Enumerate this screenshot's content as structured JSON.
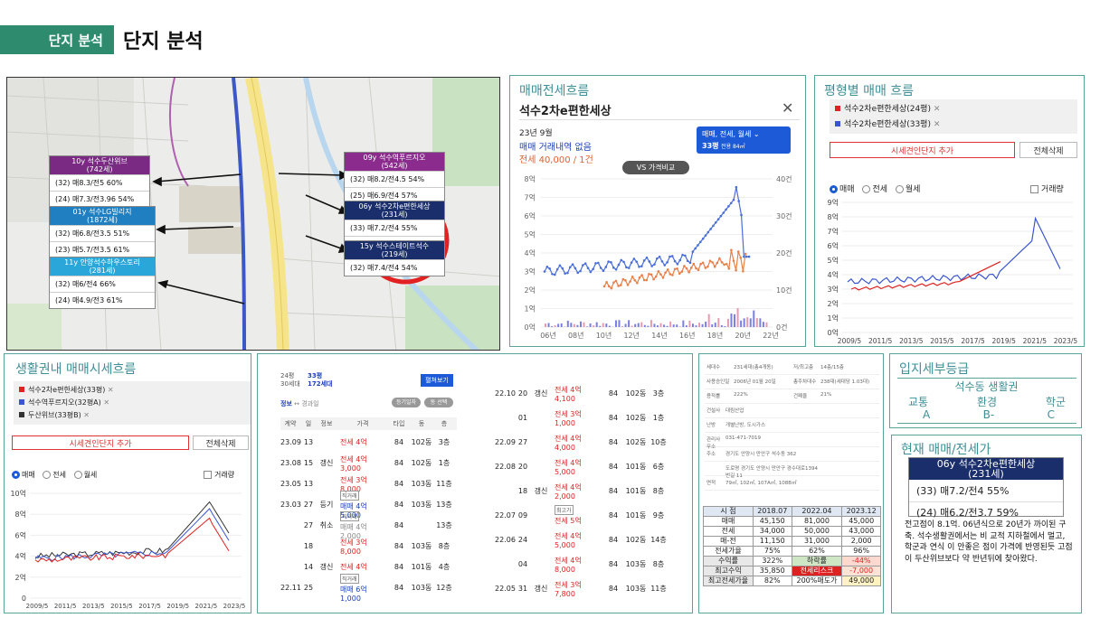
{
  "header": {
    "tag": "단지 분석",
    "title": "단지 분석"
  },
  "map": {
    "boxes": [
      {
        "head": "10y 석수두산위브\n(742세)",
        "rows": [
          "(32) 매8.3/전5 60%",
          "(24) 매7.3/전3.96 54%"
        ],
        "color": "#7a2a83"
      },
      {
        "head": "01y 석수LG빌리지\n(1872세)",
        "rows": [
          "(32) 매6.8/전3.5 51%",
          "(23) 매5.7/전3.5 61%"
        ],
        "color": "#1f7fc0"
      },
      {
        "head": "11y 안양석수하우스토리\n(281세)",
        "rows": [
          "(32) 매6/전4 66%",
          "(24) 매4.9/전3 61%"
        ],
        "color": "#2aa7d8"
      },
      {
        "head": "09y 석수역푸르지오\n(542세)",
        "rows": [
          "(32) 매8.2/전4.5 54%",
          "(25) 매6.9/전4 57%"
        ],
        "color": "#8a2b8d"
      },
      {
        "head": "06y 석수2차e편한세상\n(231세)",
        "rows": [
          "(33) 매7.2/전4 55%",
          "(24) 매6.2/전3.7 59%"
        ],
        "color": "#1a2e6c"
      },
      {
        "head": "15y 석수스테이트석수\n(219세)",
        "rows": [
          "(32) 매7.4/전4 54%"
        ],
        "color": "#1a2e6c"
      }
    ]
  },
  "flow": {
    "title": "매매전세흐름",
    "name": "석수2차e편한세상",
    "date": "23년 9월",
    "no_trade": "매매 거래내역 없음",
    "jeonse": "전세 40,000 / 1건",
    "vs": "VS 가격비교",
    "type_sel": "매매, 전세, 월세",
    "area_sel": "33평",
    "area_sub": "전용 84㎡",
    "y_left": [
      "8억",
      "7억",
      "6억",
      "5억",
      "4억",
      "3억",
      "2억",
      "1억",
      "0억"
    ],
    "y_right": [
      "40건",
      "30건",
      "20건",
      "10건",
      "0건"
    ],
    "x": [
      "06년",
      "08년",
      "10년",
      "12년",
      "14년",
      "16년",
      "18년",
      "20년",
      "22년"
    ]
  },
  "area_flow": {
    "title": "평형별 매매 흐름",
    "legend": [
      "석수2차e편한세상(24평)",
      "석수2차e편한세상(33평)"
    ],
    "add_btn": "시세견인단지 추가",
    "del_btn": "전체삭제",
    "radios": [
      "매매",
      "전세",
      "월세"
    ],
    "vol": "거래량",
    "y": [
      "9억",
      "8억",
      "7억",
      "6억",
      "5억",
      "4억",
      "3억",
      "2억",
      "1억",
      "0억"
    ],
    "x": [
      "2009/5",
      "2011/5",
      "2013/5",
      "2015/5",
      "2017/5",
      "2019/5",
      "2021/5",
      "2023/5"
    ]
  },
  "life": {
    "title": "생활권내 매매시세흐름",
    "legend": [
      "석수2차e편한세상(33평)",
      "석수역푸르지오(32평A)",
      "두산위브(33평B)"
    ],
    "add_btn": "시세견인단지 추가",
    "del_btn": "전체삭제",
    "radios": [
      "매매",
      "전세",
      "월세"
    ],
    "vol": "거래량",
    "y": [
      "10억",
      "8억",
      "6억",
      "4억",
      "2억",
      "0"
    ],
    "x": [
      "2009/5",
      "2011/5",
      "2013/5",
      "2015/5",
      "2017/5",
      "2019/5",
      "2021/5",
      "2023/5"
    ]
  },
  "trades": {
    "left_info": [
      "24평",
      "30세대"
    ],
    "sel_area": "33평",
    "sel_units": "172세대",
    "fold": "펼쳐보기",
    "tabs": [
      "정보",
      "경과일"
    ],
    "pills": [
      "등기일자",
      "동 선택"
    ],
    "headers": [
      "계약",
      "일",
      "정보",
      "가격",
      "타입",
      "동",
      "층"
    ],
    "rows_left": [
      {
        "m": "23.09",
        "d": "13",
        "i": "",
        "p": "전세 4억",
        "t": "84",
        "b": "102동",
        "f": "3층",
        "c": "red"
      },
      {
        "m": "23.08",
        "d": "15",
        "i": "갱신",
        "p": "전세 4억 3,000",
        "t": "84",
        "b": "102동",
        "f": "1층",
        "c": "red"
      },
      {
        "m": "23.05",
        "d": "13",
        "i": "",
        "p": "전세 3억 8,000",
        "t": "84",
        "b": "103동",
        "f": "11층",
        "c": "red"
      },
      {
        "m": "23.03",
        "d": "27",
        "i": "등기",
        "p": "매매 4억 5,000",
        "t": "84",
        "b": "103동",
        "f": "13층",
        "c": "blue",
        "tag": "직거래"
      },
      {
        "m": "",
        "d": "27",
        "i": "취소",
        "p": "매매 4억 2,000",
        "t": "84",
        "b": "",
        "f": "13층",
        "c": "gray",
        "tag": "직거래"
      },
      {
        "m": "",
        "d": "18",
        "i": "",
        "p": "전세 3억 8,000",
        "t": "84",
        "b": "103동",
        "f": "8층",
        "c": "red"
      },
      {
        "m": "",
        "d": "14",
        "i": "갱신",
        "p": "전세 4억",
        "t": "84",
        "b": "101동",
        "f": "4층",
        "c": "red"
      },
      {
        "m": "22.11",
        "d": "25",
        "i": "",
        "p": "매매 6억 1,000",
        "t": "84",
        "b": "103동",
        "f": "12층",
        "c": "blue",
        "tag": "직거래"
      }
    ],
    "rows_right": [
      {
        "m": "22.10",
        "d": "20",
        "i": "갱신",
        "p": "전세 4억 4,100",
        "t": "84",
        "b": "102동",
        "f": "3층",
        "c": "red"
      },
      {
        "m": "",
        "d": "01",
        "i": "",
        "p": "전세 3억 1,000",
        "t": "84",
        "b": "102동",
        "f": "1층",
        "c": "red"
      },
      {
        "m": "22.09",
        "d": "27",
        "i": "",
        "p": "전세 4억 4,000",
        "t": "84",
        "b": "102동",
        "f": "10층",
        "c": "red"
      },
      {
        "m": "22.08",
        "d": "20",
        "i": "",
        "p": "전세 4억 5,000",
        "t": "84",
        "b": "101동",
        "f": "6층",
        "c": "red"
      },
      {
        "m": "",
        "d": "18",
        "i": "갱신",
        "p": "전세 4억 2,000",
        "t": "84",
        "b": "101동",
        "f": "8층",
        "c": "red"
      },
      {
        "m": "22.07",
        "d": "09",
        "i": "",
        "p": "전세 5억",
        "t": "84",
        "b": "101동",
        "f": "9층",
        "c": "red",
        "tag": "최고가"
      },
      {
        "m": "22.06",
        "d": "24",
        "i": "",
        "p": "전세 4억 5,000",
        "t": "84",
        "b": "102동",
        "f": "14층",
        "c": "red"
      },
      {
        "m": "",
        "d": "04",
        "i": "",
        "p": "전세 4억 8,000",
        "t": "84",
        "b": "103동",
        "f": "8층",
        "c": "red"
      },
      {
        "m": "22.05",
        "d": "31",
        "i": "갱신",
        "p": "전세 3억 7,800",
        "t": "84",
        "b": "103동",
        "f": "11층",
        "c": "red"
      }
    ]
  },
  "summary": {
    "info": [
      [
        "세대수",
        "231세대(총4개동)",
        "저/최고층",
        "14층/15층"
      ],
      [
        "사용승인일",
        "2006년 01월 20일",
        "총주차대수",
        "238대(세대당 1.03대)"
      ],
      [
        "용적률",
        "222%",
        "건폐율",
        "21%"
      ],
      [
        "건설사",
        "대림산업",
        "",
        ""
      ],
      [
        "난방",
        "개별난방, 도시가스",
        "",
        ""
      ],
      [
        "관리사무소",
        "031-471-7019",
        "",
        ""
      ],
      [
        "주소",
        "경기도 안양시 만안구 석수동 362",
        "",
        ""
      ],
      [
        "",
        "도로명 경기도 안양시 만안구 경수대로1394번길 11",
        "",
        ""
      ],
      [
        "면적",
        "79㎡, 102㎡, 107A㎡, 108B㎡",
        "",
        ""
      ]
    ],
    "table": [
      [
        "시 점",
        "2018.07",
        "2022.04",
        "2023.12"
      ],
      [
        "매매",
        "45,150",
        "81,000",
        "45,000"
      ],
      [
        "전세",
        "34,000",
        "50,000",
        "43,000"
      ],
      [
        "매-전",
        "11,150",
        "31,000",
        "2,000"
      ],
      [
        "전세가율",
        "75%",
        "62%",
        "96%"
      ],
      [
        "수익률",
        "322%",
        "하락률",
        "-44%"
      ],
      [
        "최고수익",
        "35,850",
        "전세리스크",
        "-7,000"
      ],
      [
        "최고전세가율",
        "82%",
        "200%매도가",
        "49,000"
      ]
    ]
  },
  "grade": {
    "title": "입지세부등급",
    "area": "석수동 생활권",
    "cats": [
      "교통",
      "환경",
      "학군"
    ],
    "vals": [
      "A",
      "B-",
      "C"
    ]
  },
  "current": {
    "title": "현재 매매/전세가",
    "head": "06y 석수2차e편한세상\n(231세)",
    "rows": [
      "(33) 매7.2/전4 55%",
      "(24) 매6.2/전3.7 59%"
    ],
    "note": "전고점이 8.1억. 06년식으로 20년가 까이된 구축. 석수생활권에서는 비 교적 지하철에서 멀고, 학군과 연식 이 안좋은 점이 가격에 반영된듯 고점이 두산위브보다 약 반년뒤에 찾아왔다."
  },
  "colors": {
    "accent": "#3f8f96",
    "green": "#2e8b6e",
    "buy": "#4a6fd8",
    "rent": "#e8804a",
    "red": "#d22"
  }
}
